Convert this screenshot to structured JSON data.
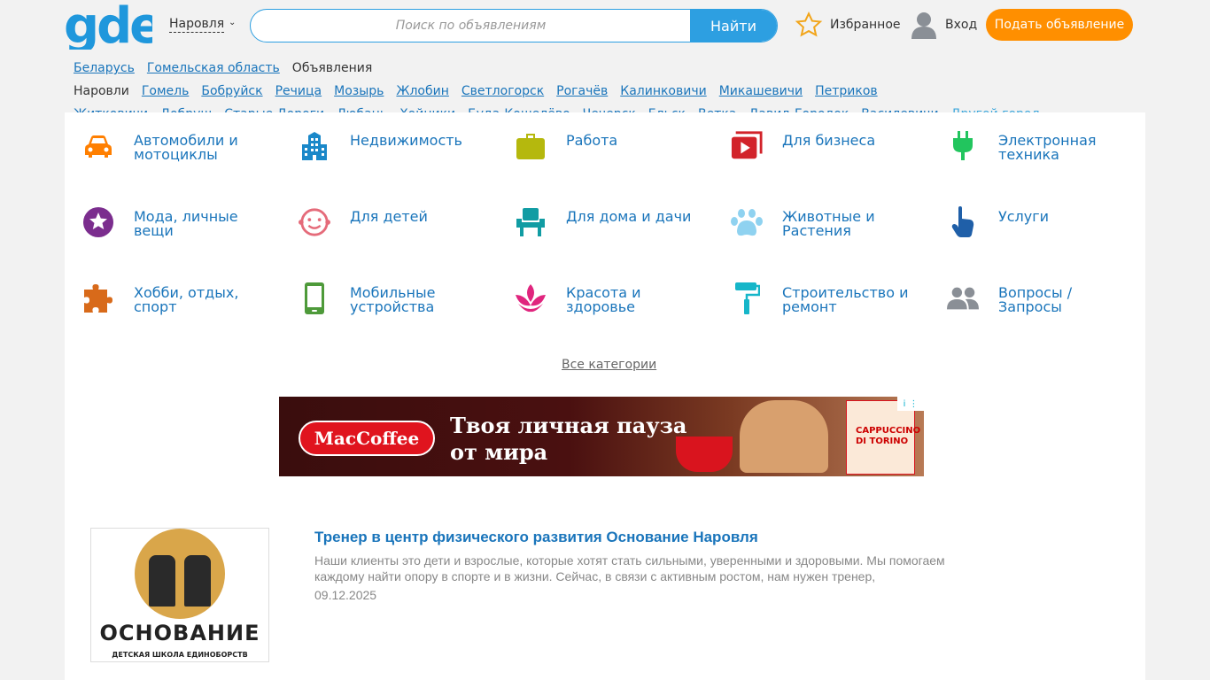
{
  "header": {
    "logo_text": "gde",
    "city": "Наровля",
    "search_placeholder": "Поиск по объявлениям",
    "search_button": "Найти",
    "favorites": "Избранное",
    "login": "Вход",
    "post_ad": "Подать объявление"
  },
  "cities": {
    "row1": [
      "Беларусь",
      "Гомельская область"
    ],
    "current": "Объявления Наровли",
    "row1b": [
      "Гомель",
      "Бобруйск",
      "Речица",
      "Мозырь",
      "Жлобин",
      "Светлогорск",
      "Рогачёв",
      "Калинковичи",
      "Микашевичи",
      "Петриков"
    ],
    "row2": [
      "Житковичи",
      "Добруш",
      "Старые Дороги",
      "Любань",
      "Хойники",
      "Буда-Кошелёво",
      "Чечерск",
      "Ельск",
      "Ветка",
      "Давид-Городок",
      "Василевичи"
    ],
    "other": "Другой город"
  },
  "categories": [
    {
      "label": "Автомобили и мотоциклы",
      "icon": "car-icon",
      "color": "#ff7f00"
    },
    {
      "label": "Недвижимость",
      "icon": "building-icon",
      "color": "#1a88c9"
    },
    {
      "label": "Работа",
      "icon": "briefcase-icon",
      "color": "#b5b80d"
    },
    {
      "label": "Для бизнеса",
      "icon": "business-play-icon",
      "color": "#d2232a"
    },
    {
      "label": "Электронная техника",
      "icon": "plug-icon",
      "color": "#22c55e"
    },
    {
      "label": "Мода, личные вещи",
      "icon": "star-circle-icon",
      "color": "#7b2d8e"
    },
    {
      "label": "Для детей",
      "icon": "baby-face-icon",
      "color": "#e56b7a"
    },
    {
      "label": "Для дома и дачи",
      "icon": "armchair-icon",
      "color": "#119ca3"
    },
    {
      "label": "Животные и Растения",
      "icon": "paw-icon",
      "color": "#8fd2f0"
    },
    {
      "label": "Услуги",
      "icon": "hand-pointer-icon",
      "color": "#1f5fa8"
    },
    {
      "label": "Хобби, отдых, спорт",
      "icon": "puzzle-icon",
      "color": "#d86a1a"
    },
    {
      "label": "Мобильные устройства",
      "icon": "smartphone-icon",
      "color": "#4e9a3a"
    },
    {
      "label": "Красота и здоровье",
      "icon": "lotus-icon",
      "color": "#e0257e"
    },
    {
      "label": "Строительство и ремонт",
      "icon": "paint-roller-icon",
      "color": "#16b6c9"
    },
    {
      "label": "Вопросы / Запросы",
      "icon": "people-icon",
      "color": "#8a8f96"
    }
  ],
  "all_categories": "Все категории",
  "ad": {
    "brand": "MacCoffee",
    "line1": "Твоя личная пауза",
    "line2": "от мира",
    "pack_text": "CAPPUCCINO DI TORINO",
    "info": "i"
  },
  "listing": {
    "title": "Тренер в центр физического развития Основание Наровля",
    "description": "Наши клиенты это дети и взрослые, которые хотят стать сильными, уверенными и здоровыми. Мы помогаем каждому найти опору в спорте и в жизни. Сейчас, в связи с активным ростом, нам нужен тренер,",
    "date": "09.12.2025",
    "thumb_name": "ОСНОВАНИЕ",
    "thumb_sub": "ДЕТСКАЯ ШКОЛА ЕДИНОБОРСТВ"
  }
}
